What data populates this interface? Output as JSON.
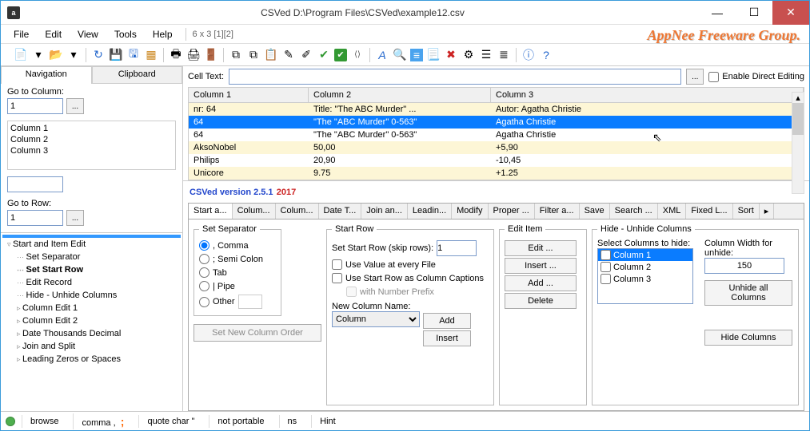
{
  "window": {
    "title": "CSVed D:\\Program Files\\CSVed\\example12.csv",
    "app_icon": "a"
  },
  "menus": {
    "file": "File",
    "edit": "Edit",
    "view": "View",
    "tools": "Tools",
    "help": "Help",
    "status": "6 x 3 [1][2]"
  },
  "brand": "AppNee Freeware Group.",
  "nav": {
    "tab_navigation": "Navigation",
    "tab_clipboard": "Clipboard",
    "goto_col_label": "Go to Column:",
    "goto_col_value": "1",
    "columns": [
      "Column 1",
      "Column 2",
      "Column 3"
    ],
    "goto_row_label": "Go to Row:",
    "goto_row_value": "1"
  },
  "tree": {
    "items": [
      {
        "t": "Start and Item Edit",
        "root": true
      },
      {
        "t": "Set Separator",
        "child": true
      },
      {
        "t": "Set Start Row",
        "child": true,
        "bold": true
      },
      {
        "t": "Edit Record",
        "child": true
      },
      {
        "t": "Hide - Unhide Columns",
        "child": true
      },
      {
        "t": "Column Edit 1"
      },
      {
        "t": "Column Edit 2"
      },
      {
        "t": "Date Thousands Decimal"
      },
      {
        "t": "Join and Split"
      },
      {
        "t": "Leading Zeros or Spaces"
      }
    ]
  },
  "celltext": {
    "label": "Cell Text:",
    "value": "",
    "direct_edit_label": "Enable Direct Editing"
  },
  "grid": {
    "headers": [
      "Column 1",
      "Column 2",
      "Column 3"
    ],
    "rows": [
      {
        "c": [
          "nr: 64",
          "Title: \"The ABC Murder\" ...",
          "Autor: Agatha Christie"
        ],
        "cls": "yellow"
      },
      {
        "c": [
          "64",
          "\"The \"ABC Murder\" 0-563\"",
          "Agatha Christie"
        ],
        "cls": "selected"
      },
      {
        "c": [
          "64",
          "\"The \"ABC Murder\" 0-563\"",
          "Agatha Christie"
        ],
        "cls": "white"
      },
      {
        "c": [
          "AksoNobel",
          "50,00",
          "+5,90"
        ],
        "cls": "yellow"
      },
      {
        "c": [
          "Philips",
          "20,90",
          "-10,45"
        ],
        "cls": "white"
      },
      {
        "c": [
          "Unicore",
          "9.75",
          "+1.25"
        ],
        "cls": "yellow"
      }
    ]
  },
  "version": {
    "text": "CSVed version 2.5.1",
    "year": "2017"
  },
  "tabs": [
    "Start a...",
    "Colum...",
    "Colum...",
    "Date T...",
    "Join an...",
    "Leadin...",
    "Modify",
    "Proper ...",
    "Filter a...",
    "Save",
    "Search ...",
    "XML",
    "Fixed L...",
    "Sort"
  ],
  "separator": {
    "legend": "Set Separator",
    "comma": ", Comma",
    "semi": "; Semi Colon",
    "tab": "Tab",
    "pipe": "| Pipe",
    "other": "Other"
  },
  "startrow": {
    "legend": "Start Row",
    "set_label": "Set Start Row (skip rows):",
    "set_value": "1",
    "use_value": "Use Value at every File",
    "use_caption": "Use Start Row as Column Captions",
    "number_prefix": "with Number Prefix",
    "new_col_label": "New Column Name:",
    "new_col_value": "Column",
    "btn_add": "Add",
    "btn_insert": "Insert",
    "btn_order": "Set New Column Order"
  },
  "edititem": {
    "legend": "Edit Item",
    "edit": "Edit ...",
    "insert": "Insert ...",
    "add": "Add ...",
    "delete": "Delete"
  },
  "hide": {
    "legend": "Hide - Unhide Columns",
    "select_label": "Select Columns to hide:",
    "cols": [
      "Column 1",
      "Column 2",
      "Column 3"
    ],
    "width_label": "Column Width for unhide:",
    "width_value": "150",
    "unhide_all": "Unhide all Columns",
    "hide_btn": "Hide Columns"
  },
  "status": {
    "browse": "browse",
    "comma": "comma ,",
    "quote": "quote char \"",
    "portable": "not portable",
    "ns": "ns",
    "hint": "Hint"
  }
}
